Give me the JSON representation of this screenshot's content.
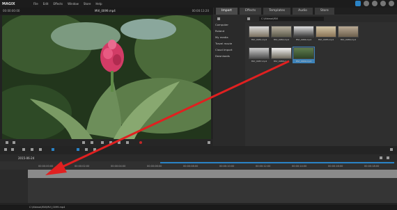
{
  "app": {
    "logo": "MAGIX"
  },
  "menu": [
    "File",
    "Edit",
    "Effects",
    "Window",
    "Store",
    "Help"
  ],
  "preview": {
    "timecode_left": "00:00:00:00",
    "title": "MVI_0099.mp4",
    "timecode_right": "00:00:13:20",
    "video_time": "13:20"
  },
  "pool": {
    "tabs": [
      "Import",
      "Effects",
      "Templates",
      "Audio",
      "Store"
    ],
    "path": "C:\\Videos\\MVI",
    "sidebar": [
      "Computer",
      "Roland",
      "My media",
      "Travel movie",
      "Cloud Import",
      "Downloads"
    ],
    "thumbs": [
      {
        "label": "MVI_0081.mp4"
      },
      {
        "label": "MVI_0082.mp4"
      },
      {
        "label": "MVI_0084.mp4"
      },
      {
        "label": "MVI_0085.mp4"
      },
      {
        "label": "MVI_0086.mp4"
      },
      {
        "label": "MVI_0087.mp4"
      },
      {
        "label": "MVI_0088.mp4"
      },
      {
        "label": "MVI_0099.mp4"
      }
    ]
  },
  "timeline": {
    "project_name": "2015-06-24",
    "ticks": [
      "00:00:00:00",
      "00:00:02:00",
      "00:00:04:00",
      "00:00:06:00",
      "00:00:08:00",
      "00:00:10:00",
      "00:00:12:00",
      "00:00:14:00",
      "00:00:16:00",
      "00:00:18:00"
    ]
  },
  "status": {
    "path": "C:\\Videos\\MVI\\MVI_0099.mp4"
  },
  "colors": {
    "accent": "#2a83c6",
    "arrow": "#e02020"
  }
}
